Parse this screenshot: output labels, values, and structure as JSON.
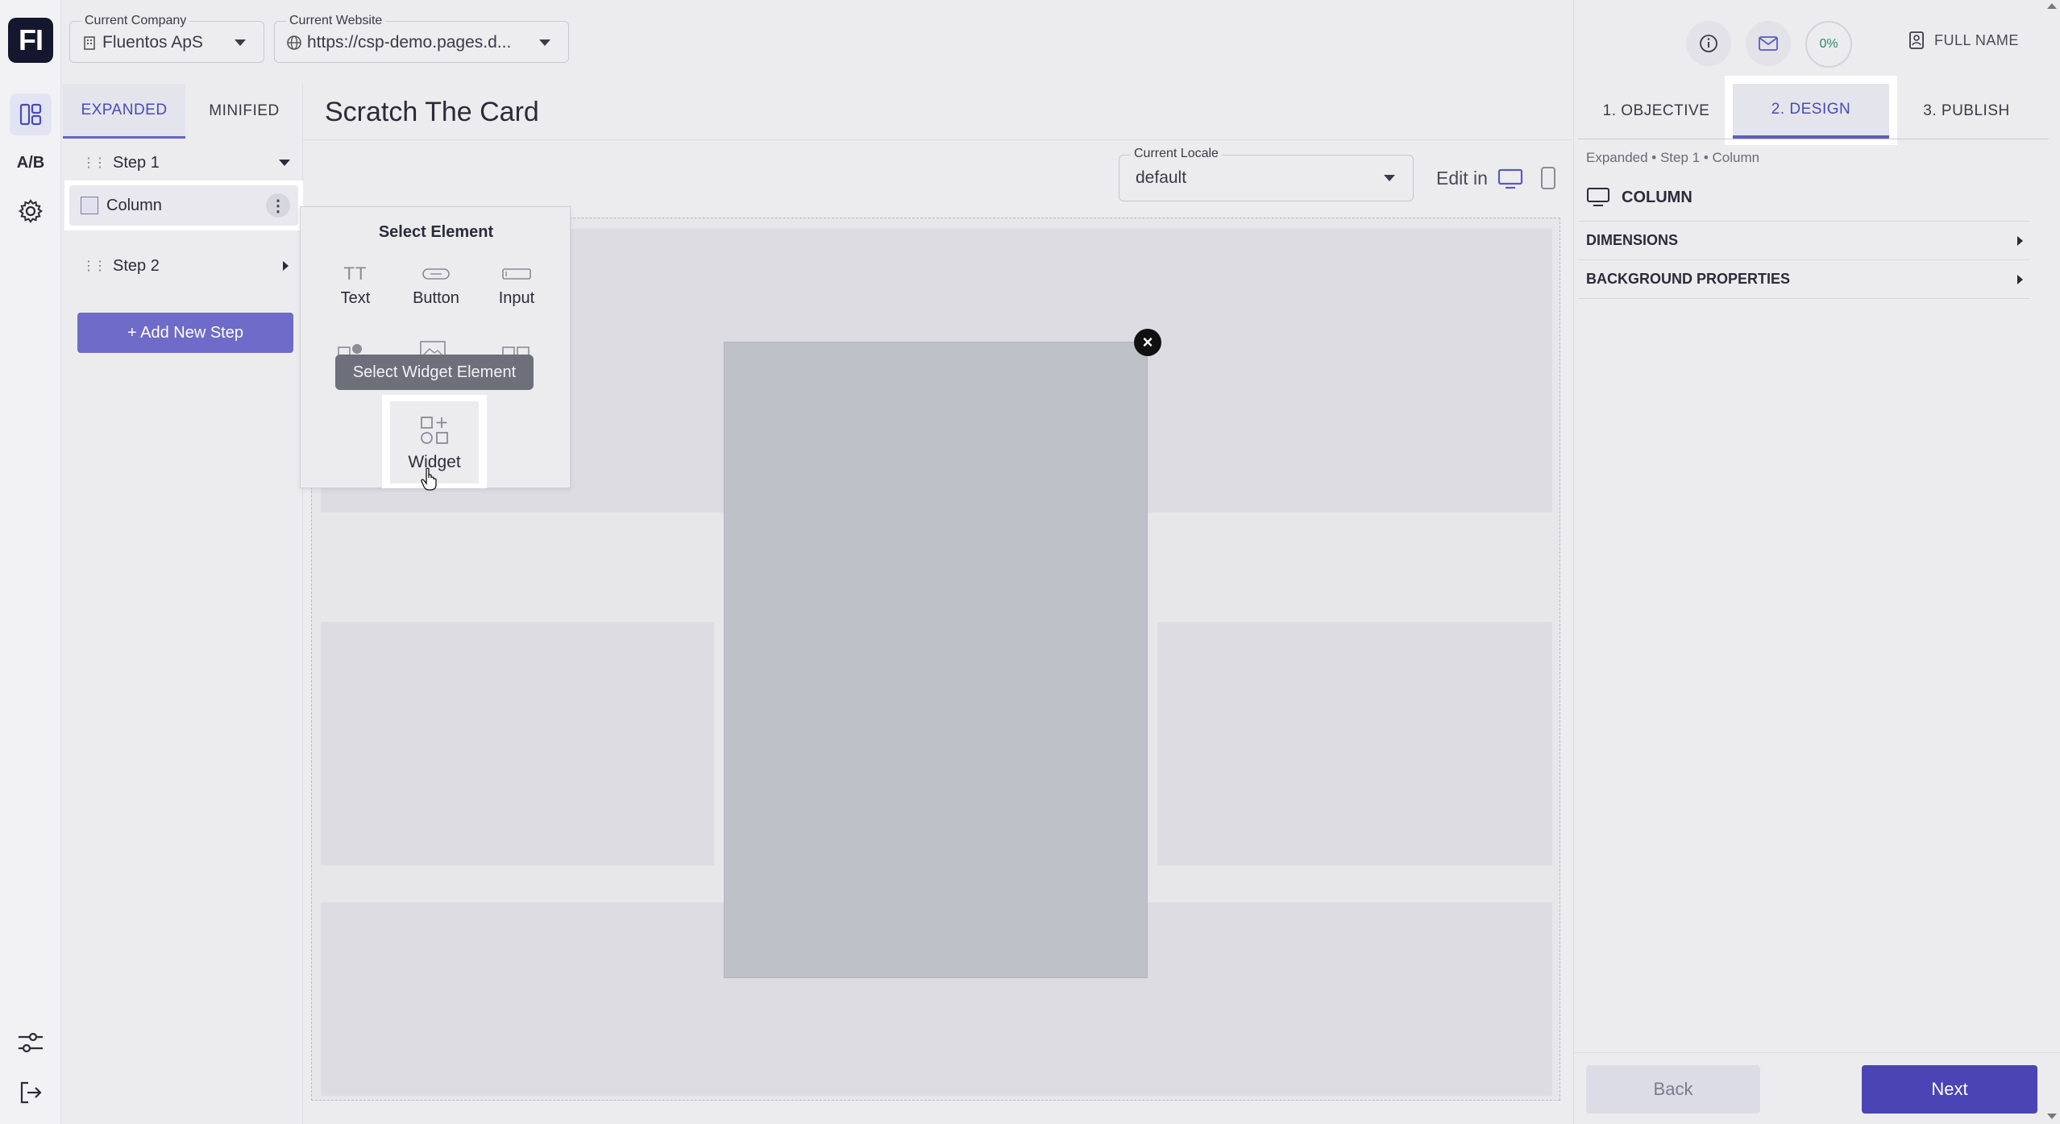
{
  "rail": {
    "logo_text": "FI",
    "ab_label": "A/B"
  },
  "header": {
    "company": {
      "label": "Current Company",
      "value": "Fluentos ApS"
    },
    "website": {
      "label": "Current Website",
      "value": "https://csp-demo.pages.d..."
    },
    "progress": "0%",
    "user_name": "FULL NAME"
  },
  "left_panel": {
    "tabs": [
      {
        "label": "EXPANDED",
        "active": true
      },
      {
        "label": "MINIFIED",
        "active": false
      }
    ],
    "step1_label": "Step 1",
    "column_label": "Column",
    "step2_label": "Step 2",
    "add_step_label": "+ Add New Step"
  },
  "canvas": {
    "page_title": "Scratch The Card",
    "locale": {
      "label": "Current Locale",
      "value": "default"
    },
    "edit_in_label": "Edit in"
  },
  "select_element": {
    "title": "Select Element",
    "items": [
      {
        "label": "Text",
        "icon": "text-icon"
      },
      {
        "label": "Button",
        "icon": "button-icon"
      },
      {
        "label": "Input",
        "icon": "input-icon"
      }
    ],
    "tooltip": "Select Widget Element",
    "widget_label": "Widget"
  },
  "right_panel": {
    "tabs": [
      {
        "label": "1. OBJECTIVE",
        "active": false
      },
      {
        "label": "2. DESIGN",
        "active": true
      },
      {
        "label": "3. PUBLISH",
        "active": false
      }
    ],
    "breadcrumb": "Expanded  •  Step 1  •  Column",
    "element_title": "COLUMN",
    "sections": [
      "DIMENSIONS",
      "BACKGROUND PROPERTIES"
    ],
    "back_label": "Back",
    "next_label": "Next"
  },
  "colors": {
    "accent": "#4a44b4",
    "accent_light": "#6f6bc9",
    "logo_bg": "#15172e"
  }
}
